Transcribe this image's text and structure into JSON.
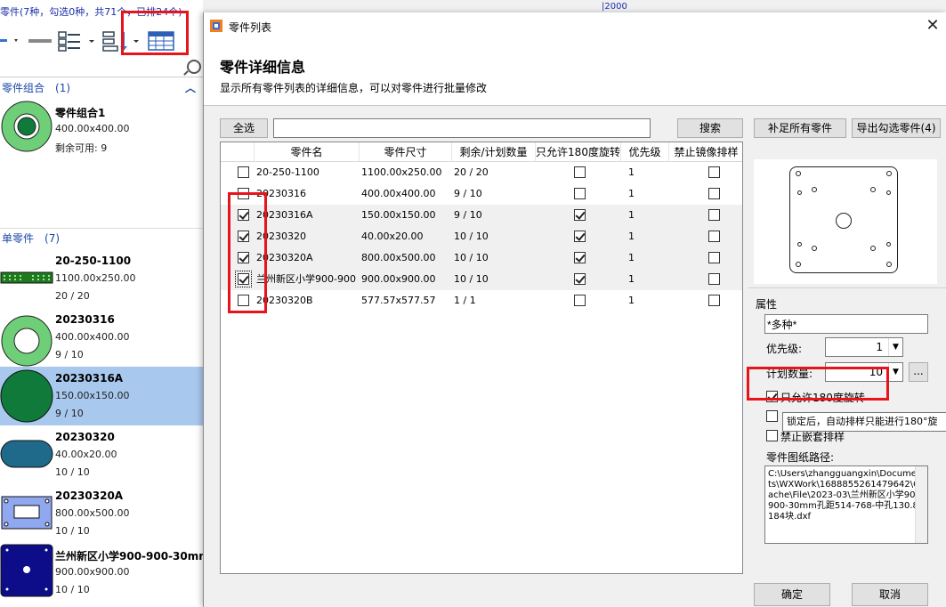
{
  "left_panel": {
    "status": "零件(7种，勾选0种，共71个，已排24个)",
    "group_combo": {
      "label": "零件组合",
      "count": "(1)"
    },
    "group_single": {
      "label": "单零件",
      "count": "(7)"
    },
    "combo_items": [
      {
        "name": "零件组合1",
        "size": "400.00x400.00",
        "remain": "剩余可用: 9"
      }
    ],
    "single_items": [
      {
        "name": "20-250-1100",
        "size": "1100.00x250.00",
        "remain": "20 / 20"
      },
      {
        "name": "20230316",
        "size": "400.00x400.00",
        "remain": "9 / 10"
      },
      {
        "name": "20230316A",
        "size": "150.00x150.00",
        "remain": "9 / 10"
      },
      {
        "name": "20230320",
        "size": "40.00x20.00",
        "remain": "10 / 10"
      },
      {
        "name": "20230320A",
        "size": "800.00x500.00",
        "remain": "10 / 10"
      },
      {
        "name": "兰州新区小学900-900-30mm",
        "size": "900.00x900.00",
        "remain": "10 / 10"
      }
    ]
  },
  "top_ruler": "|2000",
  "dialog": {
    "title": "零件列表",
    "heading": "零件详细信息",
    "subtitle": "显示所有零件列表的详细信息，可以对零件进行批量修改",
    "select_all": "全选",
    "search_button": "搜索",
    "search_value": "",
    "columns": [
      "零件名",
      "零件尺寸",
      "剩余/计划数量",
      "只允许180度旋转",
      "优先级",
      "禁止镜像排样"
    ],
    "rows": [
      {
        "checked": false,
        "name": "20-250-1100",
        "size": "1100.00x250.00",
        "remain": "20 / 20",
        "rot180": false,
        "priority": "1",
        "nomirror": false
      },
      {
        "checked": false,
        "name": "20230316",
        "size": "400.00x400.00",
        "remain": "9 / 10",
        "rot180": false,
        "priority": "1",
        "nomirror": false
      },
      {
        "checked": true,
        "name": "20230316A",
        "size": "150.00x150.00",
        "remain": "9 / 10",
        "rot180": true,
        "priority": "1",
        "nomirror": false
      },
      {
        "checked": true,
        "name": "20230320",
        "size": "40.00x20.00",
        "remain": "10 / 10",
        "rot180": true,
        "priority": "1",
        "nomirror": false
      },
      {
        "checked": true,
        "name": "20230320A",
        "size": "800.00x500.00",
        "remain": "10 / 10",
        "rot180": true,
        "priority": "1",
        "nomirror": false
      },
      {
        "checked": true,
        "name": "兰州新区小学900-900",
        "size": "900.00x900.00",
        "remain": "10 / 10",
        "rot180": true,
        "priority": "1",
        "nomirror": false
      },
      {
        "checked": false,
        "name": "20230320B",
        "size": "577.57x577.57",
        "remain": "1 / 1",
        "rot180": false,
        "priority": "1",
        "nomirror": false
      }
    ],
    "right": {
      "fill_all_button": "补足所有零件",
      "export_button": "导出勾选零件(4)",
      "props_label": "属性",
      "name_value": "*多种*",
      "priority_label": "优先级:",
      "priority_value": "1",
      "plan_label": "计划数量:",
      "plan_value": "10",
      "more_button": "...",
      "rot180_label": "只允许180度旋转",
      "rot180_checked": true,
      "tooltip": "锁定后，自动排样只能进行180°旋",
      "nest_label": "禁止嵌套排样",
      "path_label": "零件图纸路径:",
      "path_value": "C:\\Users\\zhangguangxin\\Documents\\WXWork\\1688855261479642\\Cache\\File\\2023-03\\兰州新区小学900-900-30mm孔距514-768-中孔130.8-184块.dxf"
    },
    "ok_button": "确定",
    "cancel_button": "取消"
  },
  "colors": {
    "accent_red": "#e8141b",
    "link_blue": "#1c49a8",
    "part_green": "#6ecf78",
    "part_dark_green": "#0f7a3a",
    "part_navy": "#0d0d8a",
    "selection": "#a9c8ee"
  }
}
